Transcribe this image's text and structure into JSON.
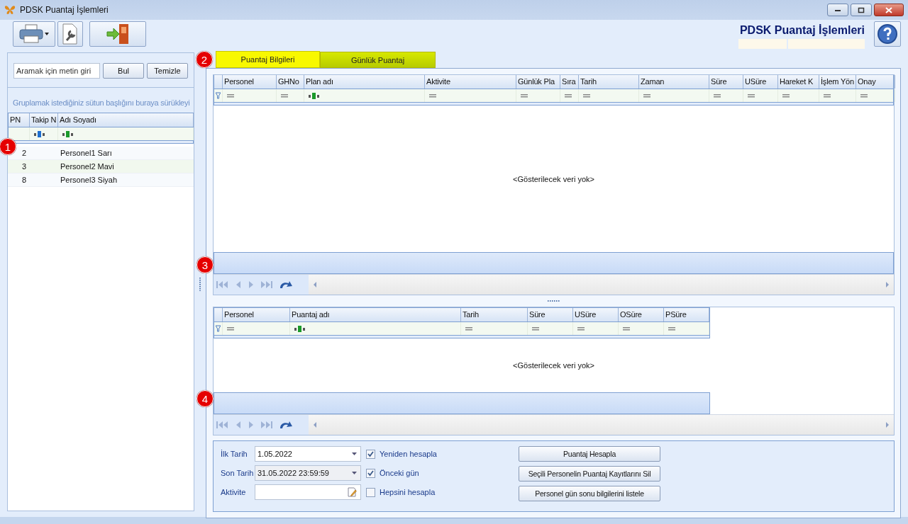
{
  "window": {
    "title": "PDSK Puantaj İşlemleri"
  },
  "header": {
    "heading": "PDSK Puantaj İşlemleri"
  },
  "left_panel": {
    "marker": "1",
    "search": {
      "placeholder": "Aramak için metin giri"
    },
    "buttons": [
      "Bul",
      "Temizle"
    ],
    "group_hint": "Gruplamak istediğiniz sütun başlığını buraya sürükleyi",
    "grid": {
      "columns": [
        {
          "label": "PN",
          "kind": "plain"
        },
        {
          "label": "Takip N",
          "kind": "abc",
          "color": "#1f6fd0"
        },
        {
          "label": "Adı Soyadı",
          "kind": "abc",
          "color": "#1a9a2a"
        }
      ],
      "rows": [
        [
          "2",
          "",
          "Personel1 Sarı"
        ],
        [
          "3",
          "",
          "Personel2 Mavi"
        ],
        [
          "8",
          "",
          "Personel3 Siyah"
        ]
      ]
    }
  },
  "tabs_marker": "2",
  "tabs": [
    {
      "label": "Puantaj Bilgileri",
      "selected": true
    },
    {
      "label": "Günlük Puantaj",
      "selected": false
    }
  ],
  "upper_grid": {
    "marker": "3",
    "columns": [
      {
        "label": "Personel",
        "kind": "eq"
      },
      {
        "label": "GHNo",
        "kind": "eq"
      },
      {
        "label": "Plan adı",
        "kind": "abc",
        "color": "#1a9a2a"
      },
      {
        "label": "Aktivite",
        "kind": "eq"
      },
      {
        "label": "Günlük Pla",
        "kind": "eq"
      },
      {
        "label": "Sıra",
        "kind": "eq"
      },
      {
        "label": "Tarih",
        "kind": "eq"
      },
      {
        "label": "Zaman",
        "kind": "eq"
      },
      {
        "label": "Süre",
        "kind": "eq"
      },
      {
        "label": "USüre",
        "kind": "eq"
      },
      {
        "label": "Hareket K",
        "kind": "eq"
      },
      {
        "label": "İşlem Yön",
        "kind": "eq"
      },
      {
        "label": "Onay",
        "kind": "eq"
      }
    ],
    "empty_text": "<Gösterilecek veri yok>"
  },
  "lower_grid": {
    "marker": "4",
    "columns": [
      {
        "label": "Personel",
        "kind": "eq"
      },
      {
        "label": "Puantaj adı",
        "kind": "abc",
        "color": "#1a9a2a"
      },
      {
        "label": "Tarih",
        "kind": "eq"
      },
      {
        "label": "Süre",
        "kind": "eq"
      },
      {
        "label": "USüre",
        "kind": "eq"
      },
      {
        "label": "OSüre",
        "kind": "eq"
      },
      {
        "label": "PSüre",
        "kind": "eq"
      }
    ],
    "empty_text": "<Gösterilecek veri yok>"
  },
  "form": {
    "fields": [
      {
        "label": "İlk Tarih",
        "value": "1.05.2022",
        "kind": "date",
        "disabled": false
      },
      {
        "label": "Son Tarih",
        "value": "31.05.2022 23:59:59",
        "kind": "date",
        "disabled": true
      },
      {
        "label": "Aktivite",
        "kind": "text",
        "disabled": false
      }
    ],
    "checkboxes": [
      {
        "label": "Yeniden hesapla",
        "checked": true
      },
      {
        "label": "Önceki gün",
        "checked": true
      },
      {
        "label": "Hepsini hesapla",
        "checked": false
      }
    ],
    "buttons": [
      "Puantaj Hesapla",
      "Seçili Personelin Puantaj Kayıtlarını Sil",
      "Personel gün sonu bilgilerini listele"
    ]
  }
}
